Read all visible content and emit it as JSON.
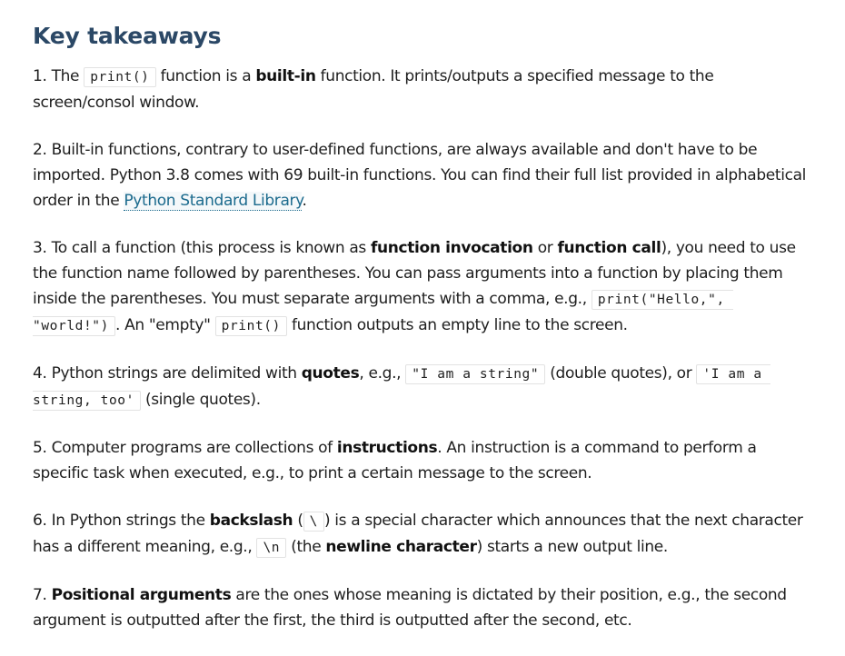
{
  "heading": "Key takeaways",
  "items": [
    {
      "t1": "1. The ",
      "code1": "print()",
      "t2": " function is a ",
      "b1": "built-in",
      "t3": " function. It prints/outputs a specified message to the screen/consol window."
    },
    {
      "t1": "2. Built-in functions, contrary to user-defined functions, are always available and don't have to be imported. Python 3.8 comes with 69 built-in functions. You can find their full list provided in alphabetical order in the ",
      "link": "Python Standard Library",
      "t2": "."
    },
    {
      "t1": "3. To call a function (this process is known as ",
      "b1": "function invocation",
      "t2": " or ",
      "b2": "function call",
      "t3": "), you need to use the function name followed by parentheses. You can pass arguments into a function by placing them inside the parentheses. You must separate arguments with a comma, e.g., ",
      "code1": "print(\"Hello,\", \"world!\")",
      "t4": ". An \"empty\" ",
      "code2": "print()",
      "t5": " function outputs an empty line to the screen."
    },
    {
      "t1": "4. Python strings are delimited with ",
      "b1": "quotes",
      "t2": ", e.g., ",
      "code1": "\"I am a string\"",
      "t3": " (double quotes), or ",
      "code2": "'I am a string, too'",
      "t4": " (single quotes)."
    },
    {
      "t1": "5. Computer programs are collections of ",
      "b1": "instructions",
      "t2": ". An instruction is a command to perform a specific task when executed, e.g., to print a certain message to the screen."
    },
    {
      "t1": "6. In Python strings the ",
      "b1": "backslash",
      "t2": " (",
      "code1": "\\",
      "t3": ") is a special character which announces that the next character has a different meaning, e.g., ",
      "code2": "\\n",
      "t4": " (the ",
      "b2": "newline character",
      "t5": ") starts a new output line."
    },
    {
      "t1": "7. ",
      "b1": "Positional arguments",
      "t2": " are the ones whose meaning is dictated by their position, e.g., the second argument is outputted after the first, the third is outputted after the second, etc."
    }
  ]
}
